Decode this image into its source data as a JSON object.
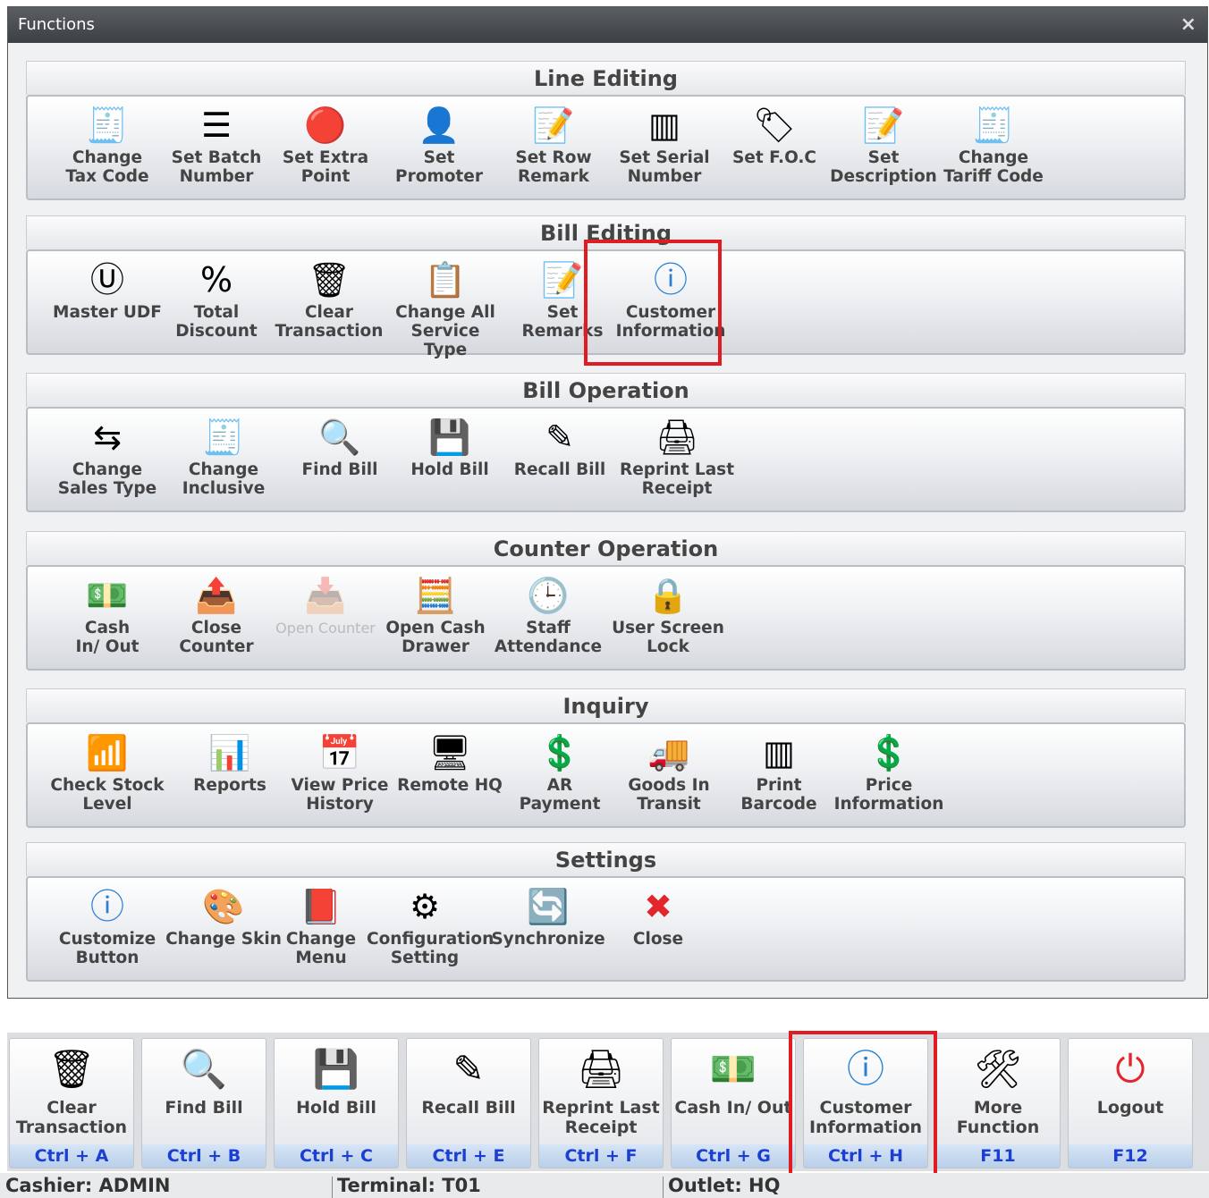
{
  "window": {
    "title": "Functions",
    "close_glyph": "×"
  },
  "groups": [
    {
      "title": "Line Editing",
      "items": [
        {
          "label": "Change\nTax Code",
          "icon": "tax-form-icon",
          "glyph": "🧾"
        },
        {
          "label": "Set Batch\nNumber",
          "icon": "numbered-list-icon",
          "glyph": "☰"
        },
        {
          "label": "Set Extra\nPoint",
          "icon": "point-badge-icon",
          "glyph": "🔴"
        },
        {
          "label": "Set Promoter",
          "icon": "user-icon",
          "glyph": "👤"
        },
        {
          "label": "Set Row\nRemark",
          "icon": "note-pencil-icon",
          "glyph": "📝"
        },
        {
          "label": "Set Serial\nNumber",
          "icon": "barcode-icon",
          "glyph": "▥"
        },
        {
          "label": "Set F.O.C",
          "icon": "free-badge-icon",
          "glyph": "🏷"
        },
        {
          "label": "Set\nDescription",
          "icon": "note-pencil-icon",
          "glyph": "📝"
        },
        {
          "label": "Change\nTariff Code",
          "icon": "tax-form-icon",
          "glyph": "🧾"
        }
      ]
    },
    {
      "title": "Bill Editing",
      "items": [
        {
          "label": "Master UDF",
          "icon": "udf-icon",
          "glyph": "Ⓤ"
        },
        {
          "label": "Total\nDiscount",
          "icon": "percent-icon",
          "glyph": "%"
        },
        {
          "label": "Clear\nTransaction",
          "icon": "trash-can-icon",
          "glyph": "🗑"
        },
        {
          "label": "Change All\nService Type",
          "icon": "clipboard-icon",
          "glyph": "📋"
        },
        {
          "label": "Set\nRemarks",
          "icon": "note-pencil-icon",
          "glyph": "📝"
        },
        {
          "label": "Customer\nInformation",
          "icon": "info-icon",
          "glyph": "ⓘ"
        }
      ]
    },
    {
      "title": "Bill Operation",
      "items": [
        {
          "label": "Change\nSales Type",
          "icon": "swap-arrows-icon",
          "glyph": "⇆"
        },
        {
          "label": "Change\nInclusive",
          "icon": "tax-form-icon",
          "glyph": "🧾"
        },
        {
          "label": "Find Bill",
          "icon": "magnifier-icon",
          "glyph": "🔍"
        },
        {
          "label": "Hold Bill",
          "icon": "floppy-disk-icon",
          "glyph": "💾"
        },
        {
          "label": "Recall Bill",
          "icon": "pencil-disk-icon",
          "glyph": "✎"
        },
        {
          "label": "Reprint Last\nReceipt",
          "icon": "printer-icon",
          "glyph": "🖨"
        }
      ]
    },
    {
      "title": "Counter Operation",
      "items": [
        {
          "label": "Cash\nIn/ Out",
          "icon": "cash-icon",
          "glyph": "💵"
        },
        {
          "label": "Close\nCounter",
          "icon": "close-counter-icon",
          "glyph": "📤"
        },
        {
          "label": "Open Counter",
          "icon": "open-counter-icon",
          "glyph": "📥",
          "disabled": true
        },
        {
          "label": "Open Cash\nDrawer",
          "icon": "cash-register-icon",
          "glyph": "🧮"
        },
        {
          "label": "Staff\nAttendance",
          "icon": "clock-calendar-icon",
          "glyph": "🕒"
        },
        {
          "label": "User Screen\nLock",
          "icon": "screen-lock-icon",
          "glyph": "🔒"
        }
      ]
    },
    {
      "title": "Inquiry",
      "items": [
        {
          "label": "Check Stock\nLevel",
          "icon": "bar-levels-icon",
          "glyph": "📶"
        },
        {
          "label": "Reports",
          "icon": "report-chart-icon",
          "glyph": "📊"
        },
        {
          "label": "View Price\nHistory",
          "icon": "calendar-list-icon",
          "glyph": "📅"
        },
        {
          "label": "Remote HQ",
          "icon": "remote-monitor-icon",
          "glyph": "🖥"
        },
        {
          "label": "AR\nPayment",
          "icon": "dollar-document-icon",
          "glyph": "💲"
        },
        {
          "label": "Goods In\nTransit",
          "icon": "delivery-truck-icon",
          "glyph": "🚚"
        },
        {
          "label": "Print\nBarcode",
          "icon": "barcode-icon",
          "glyph": "▥"
        },
        {
          "label": "Price\nInformation",
          "icon": "price-tag-icon",
          "glyph": "💲"
        }
      ]
    },
    {
      "title": "Settings",
      "items": [
        {
          "label": "Customize\nButton",
          "icon": "info-icon",
          "glyph": "ⓘ"
        },
        {
          "label": "Change Skin",
          "icon": "paint-palette-icon",
          "glyph": "🎨"
        },
        {
          "label": "Change\nMenu",
          "icon": "menu-book-icon",
          "glyph": "📕"
        },
        {
          "label": "Configuration\nSetting",
          "icon": "config-window-icon",
          "glyph": "⚙"
        },
        {
          "label": "Synchronize",
          "icon": "sync-icon",
          "glyph": "🔄"
        },
        {
          "label": "Close",
          "icon": "close-circle-icon",
          "glyph": "✖"
        }
      ]
    }
  ],
  "bottom_buttons": [
    {
      "label": "Clear\nTransaction",
      "key": "Ctrl + A",
      "icon": "trash-can-icon",
      "glyph": "🗑"
    },
    {
      "label": "Find Bill",
      "key": "Ctrl + B",
      "icon": "magnifier-icon",
      "glyph": "🔍"
    },
    {
      "label": "Hold Bill",
      "key": "Ctrl + C",
      "icon": "floppy-disk-icon",
      "glyph": "💾"
    },
    {
      "label": "Recall Bill",
      "key": "Ctrl + E",
      "icon": "pencil-disk-icon",
      "glyph": "✎"
    },
    {
      "label": "Reprint Last\nReceipt",
      "key": "Ctrl + F",
      "icon": "printer-icon",
      "glyph": "🖨"
    },
    {
      "label": "Cash In/ Out",
      "key": "Ctrl + G",
      "icon": "cash-icon",
      "glyph": "💵"
    },
    {
      "label": "Customer\nInformation",
      "key": "Ctrl + H",
      "icon": "info-icon",
      "glyph": "ⓘ"
    },
    {
      "label": "More\nFunction",
      "key": "F11",
      "icon": "tools-icon",
      "glyph": "🛠"
    },
    {
      "label": "Logout",
      "key": "F12",
      "icon": "power-icon",
      "glyph": "⏻"
    }
  ],
  "status": {
    "cashier": "Cashier: ADMIN",
    "terminal": "Terminal: T01",
    "outlet": "Outlet: HQ"
  },
  "colors": {
    "highlight": "#e01b22",
    "shortcut_text": "#1a3fd1",
    "info_blue": "#2a7fd4",
    "close_red": "#e3262b"
  }
}
